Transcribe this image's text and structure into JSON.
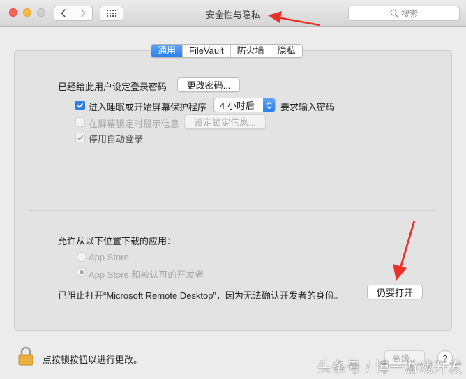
{
  "window": {
    "title": "安全性与隐私",
    "search_placeholder": "搜索"
  },
  "tabs": [
    {
      "label": "通用",
      "active": true
    },
    {
      "label": "FileVault",
      "active": false
    },
    {
      "label": "防火墙",
      "active": false
    },
    {
      "label": "隐私",
      "active": false
    }
  ],
  "general": {
    "password_label": "已经给此用户设定登录密码",
    "change_password_button": "更改密码...",
    "require_password": {
      "label": "进入睡眠或开始屏幕保护程序",
      "checked": true,
      "select_value": "4 小时后",
      "suffix": "要求输入密码"
    },
    "lock_message": {
      "label": "在屏幕锁定时显示信息",
      "checked": false,
      "disabled": true,
      "button": "设定锁定信息..."
    },
    "auto_login": {
      "label": "停用自动登录",
      "checked": true,
      "disabled": true
    }
  },
  "downloads": {
    "heading": "允许从以下位置下载的应用：",
    "options": [
      {
        "label": "App Store",
        "selected": false
      },
      {
        "label": "App Store 和被认可的开发者",
        "selected": true
      }
    ],
    "blocked_message": "已阻止打开“Microsoft Remote Desktop”，因为无法确认开发者的身份。",
    "open_anyway_button": "仍要打开"
  },
  "footer": {
    "lock_text": "点按锁按钮以进行更改。",
    "advanced_button": "高级...",
    "help_button": "?"
  },
  "watermark": "头条号 / 博一游戏开发",
  "colors": {
    "accent": "#2f80f1",
    "annotation_arrow": "#e8312a",
    "lock": "#e6a838"
  }
}
